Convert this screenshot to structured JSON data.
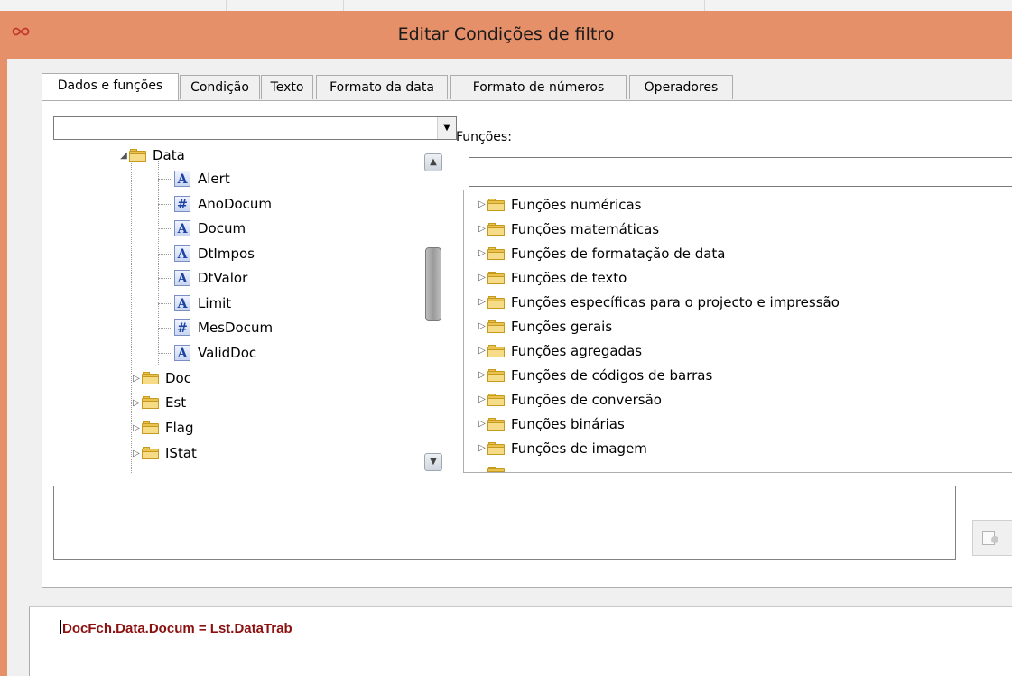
{
  "window": {
    "title": "Editar Condições de filtro",
    "app_icon": "infinity-app-icon"
  },
  "tabs": [
    {
      "label": "Dados e funções",
      "active": true
    },
    {
      "label": "Condição",
      "active": false
    },
    {
      "label": "Texto",
      "active": false
    },
    {
      "label": "Formato da data",
      "active": false
    },
    {
      "label": "Formato de números",
      "active": false
    },
    {
      "label": "Operadores",
      "active": false
    }
  ],
  "data_panel": {
    "combo_value": "",
    "tree": {
      "expanded_folder": "Data",
      "fields": [
        {
          "label": "Alert",
          "type": "A"
        },
        {
          "label": "AnoDocum",
          "type": "#"
        },
        {
          "label": "Docum",
          "type": "A"
        },
        {
          "label": "DtImpos",
          "type": "A"
        },
        {
          "label": "DtValor",
          "type": "A"
        },
        {
          "label": "Limit",
          "type": "A"
        },
        {
          "label": "MesDocum",
          "type": "#"
        },
        {
          "label": "ValidDoc",
          "type": "A"
        }
      ],
      "folders": [
        "Doc",
        "Est",
        "Flag",
        "IStat"
      ]
    }
  },
  "functions_panel": {
    "label": "Funções:",
    "search_value": "",
    "items": [
      "Funções numéricas",
      "Funções matemáticas",
      "Funções de formatação de data",
      "Funções de texto",
      "Funções específicas para o projecto e impressão",
      "Funções gerais",
      "Funções agregadas",
      "Funções de códigos de barras",
      "Funções de conversão",
      "Funções binárias",
      "Funções de imagem"
    ]
  },
  "expression_box": {
    "value": ""
  },
  "condition": {
    "text": "DocFch.Data.Docum = Lst.DataTrab",
    "color": "#8b1010"
  },
  "colors": {
    "titlebar": "#e6906a",
    "panel": "#f0f0f0",
    "folder": "#e9c24f"
  }
}
